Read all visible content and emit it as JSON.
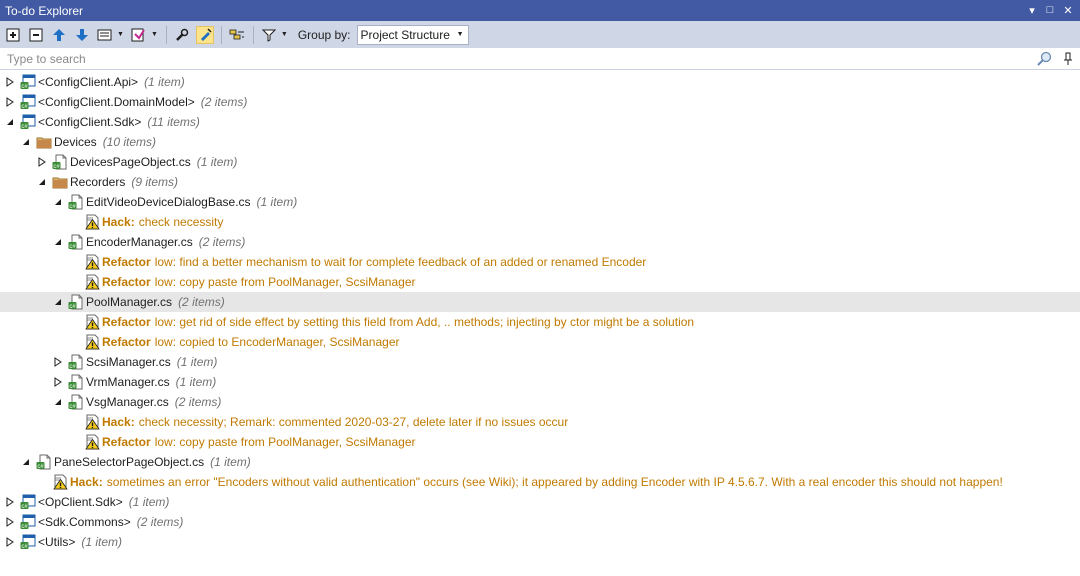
{
  "window": {
    "title": "To-do Explorer"
  },
  "toolbar": {
    "group_by_label": "Group by:",
    "group_by_value": "Project Structure"
  },
  "search": {
    "placeholder": "Type to search"
  },
  "tree": [
    {
      "level": 0,
      "kind": "project",
      "expander": "collapsed",
      "label": "<ConfigClient.Api>",
      "count": "(1 item)"
    },
    {
      "level": 0,
      "kind": "project",
      "expander": "collapsed",
      "label": "<ConfigClient.DomainModel>",
      "count": "(2 items)"
    },
    {
      "level": 0,
      "kind": "project",
      "expander": "expanded",
      "label": "<ConfigClient.Sdk>",
      "count": "(11 items)"
    },
    {
      "level": 1,
      "kind": "folder",
      "expander": "expanded",
      "label": "Devices",
      "count": "(10 items)"
    },
    {
      "level": 2,
      "kind": "file",
      "expander": "collapsed",
      "label": "DevicesPageObject.cs",
      "count": "(1 item)"
    },
    {
      "level": 2,
      "kind": "folder",
      "expander": "expanded",
      "label": "Recorders",
      "count": "(9 items)"
    },
    {
      "level": 3,
      "kind": "file",
      "expander": "expanded",
      "label": "EditVideoDeviceDialogBase.cs",
      "count": "(1 item)"
    },
    {
      "level": 4,
      "kind": "todo",
      "expander": "none",
      "type": "Hack:",
      "text": "check necessity"
    },
    {
      "level": 3,
      "kind": "file",
      "expander": "expanded",
      "label": "EncoderManager.cs",
      "count": "(2 items)"
    },
    {
      "level": 4,
      "kind": "todo",
      "expander": "none",
      "type": "Refactor",
      "text": "low: find a better mechanism to wait for complete feedback of an added or renamed Encoder"
    },
    {
      "level": 4,
      "kind": "todo",
      "expander": "none",
      "type": "Refactor",
      "text": "low: copy paste from PoolManager, ScsiManager"
    },
    {
      "level": 3,
      "kind": "file",
      "expander": "expanded",
      "label": "PoolManager.cs",
      "count": "(2 items)",
      "selected": true
    },
    {
      "level": 4,
      "kind": "todo",
      "expander": "none",
      "type": "Refactor",
      "text": "low: get rid of side effect by setting this field from Add, .. methods; injecting by ctor might be a solution"
    },
    {
      "level": 4,
      "kind": "todo",
      "expander": "none",
      "type": "Refactor",
      "text": "low: copied to EncoderManager, ScsiManager"
    },
    {
      "level": 3,
      "kind": "file",
      "expander": "collapsed",
      "label": "ScsiManager.cs",
      "count": "(1 item)"
    },
    {
      "level": 3,
      "kind": "file",
      "expander": "collapsed",
      "label": "VrmManager.cs",
      "count": "(1 item)"
    },
    {
      "level": 3,
      "kind": "file",
      "expander": "expanded",
      "label": "VsgManager.cs",
      "count": "(2 items)"
    },
    {
      "level": 4,
      "kind": "todo",
      "expander": "none",
      "type": "Hack:",
      "text": "check necessity; Remark: commented 2020-03-27, delete later if no issues occur"
    },
    {
      "level": 4,
      "kind": "todo",
      "expander": "none",
      "type": "Refactor",
      "text": "low: copy paste from PoolManager, ScsiManager"
    },
    {
      "level": 1,
      "kind": "file",
      "expander": "expanded",
      "label": "PaneSelectorPageObject.cs",
      "count": "(1 item)"
    },
    {
      "level": 2,
      "kind": "todo",
      "expander": "none",
      "type": "Hack:",
      "text": "sometimes an error \"Encoders without valid authentication\" occurs (see Wiki); it appeared by adding Encoder with IP 4.5.6.7. With a real encoder this should not happen!"
    },
    {
      "level": 0,
      "kind": "project",
      "expander": "collapsed",
      "label": "<OpClient.Sdk>",
      "count": "(1 item)"
    },
    {
      "level": 0,
      "kind": "project",
      "expander": "collapsed",
      "label": "<Sdk.Commons>",
      "count": "(2 items)"
    },
    {
      "level": 0,
      "kind": "project",
      "expander": "collapsed",
      "label": "<Utils>",
      "count": "(1 item)"
    }
  ]
}
